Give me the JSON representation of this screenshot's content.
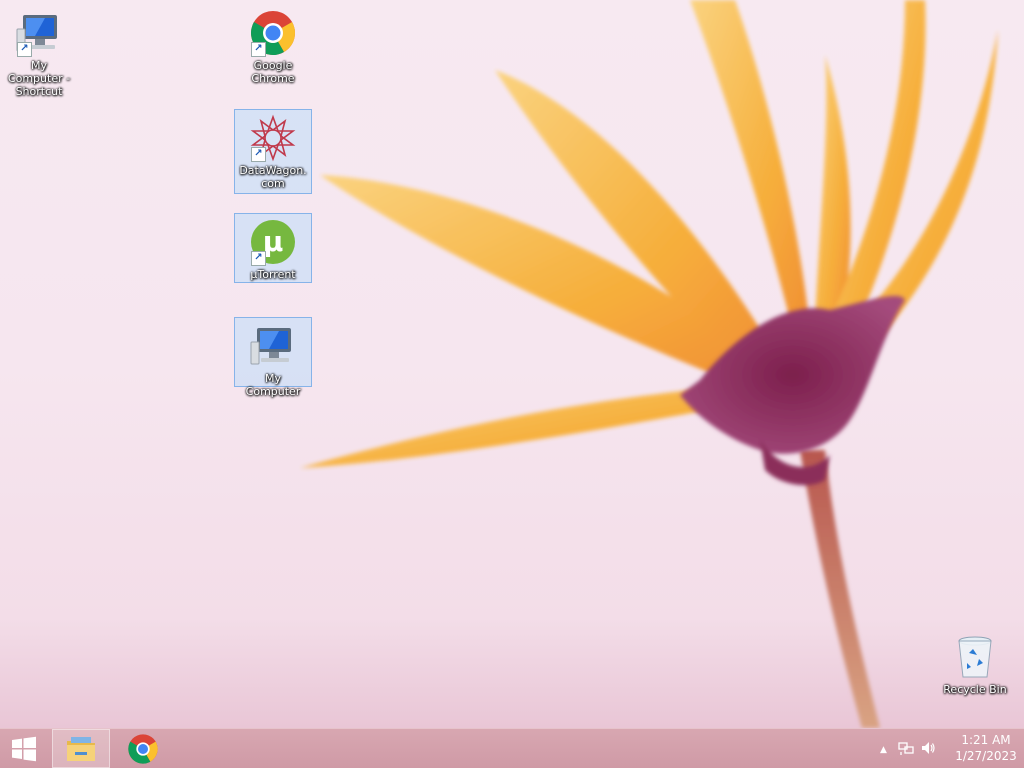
{
  "desktop": {
    "icons": [
      {
        "label": "My Computer - Shortcut",
        "icon": "computer-icon",
        "shortcut": true
      },
      {
        "label": "Google Chrome",
        "icon": "chrome-icon",
        "shortcut": true
      },
      {
        "label": "DataWagon.com",
        "icon": "datawagon-icon",
        "shortcut": true
      },
      {
        "label": "µTorrent",
        "icon": "utorrent-icon",
        "shortcut": true
      },
      {
        "label": "My Computer",
        "icon": "computer-icon",
        "shortcut": false
      },
      {
        "label": "Recycle Bin",
        "icon": "recycle-bin-icon",
        "shortcut": false
      }
    ]
  },
  "taskbar": {
    "start": "windows-logo-icon",
    "pinned": [
      "file-explorer-icon",
      "chrome-icon"
    ],
    "tray": {
      "show_hidden": "▲",
      "time": "1:21 AM",
      "date": "1/27/2023"
    }
  },
  "colors": {
    "wallpaper": "#f6e6ef",
    "taskbar": "#d4a1ac",
    "petal": "#f7b23b"
  }
}
